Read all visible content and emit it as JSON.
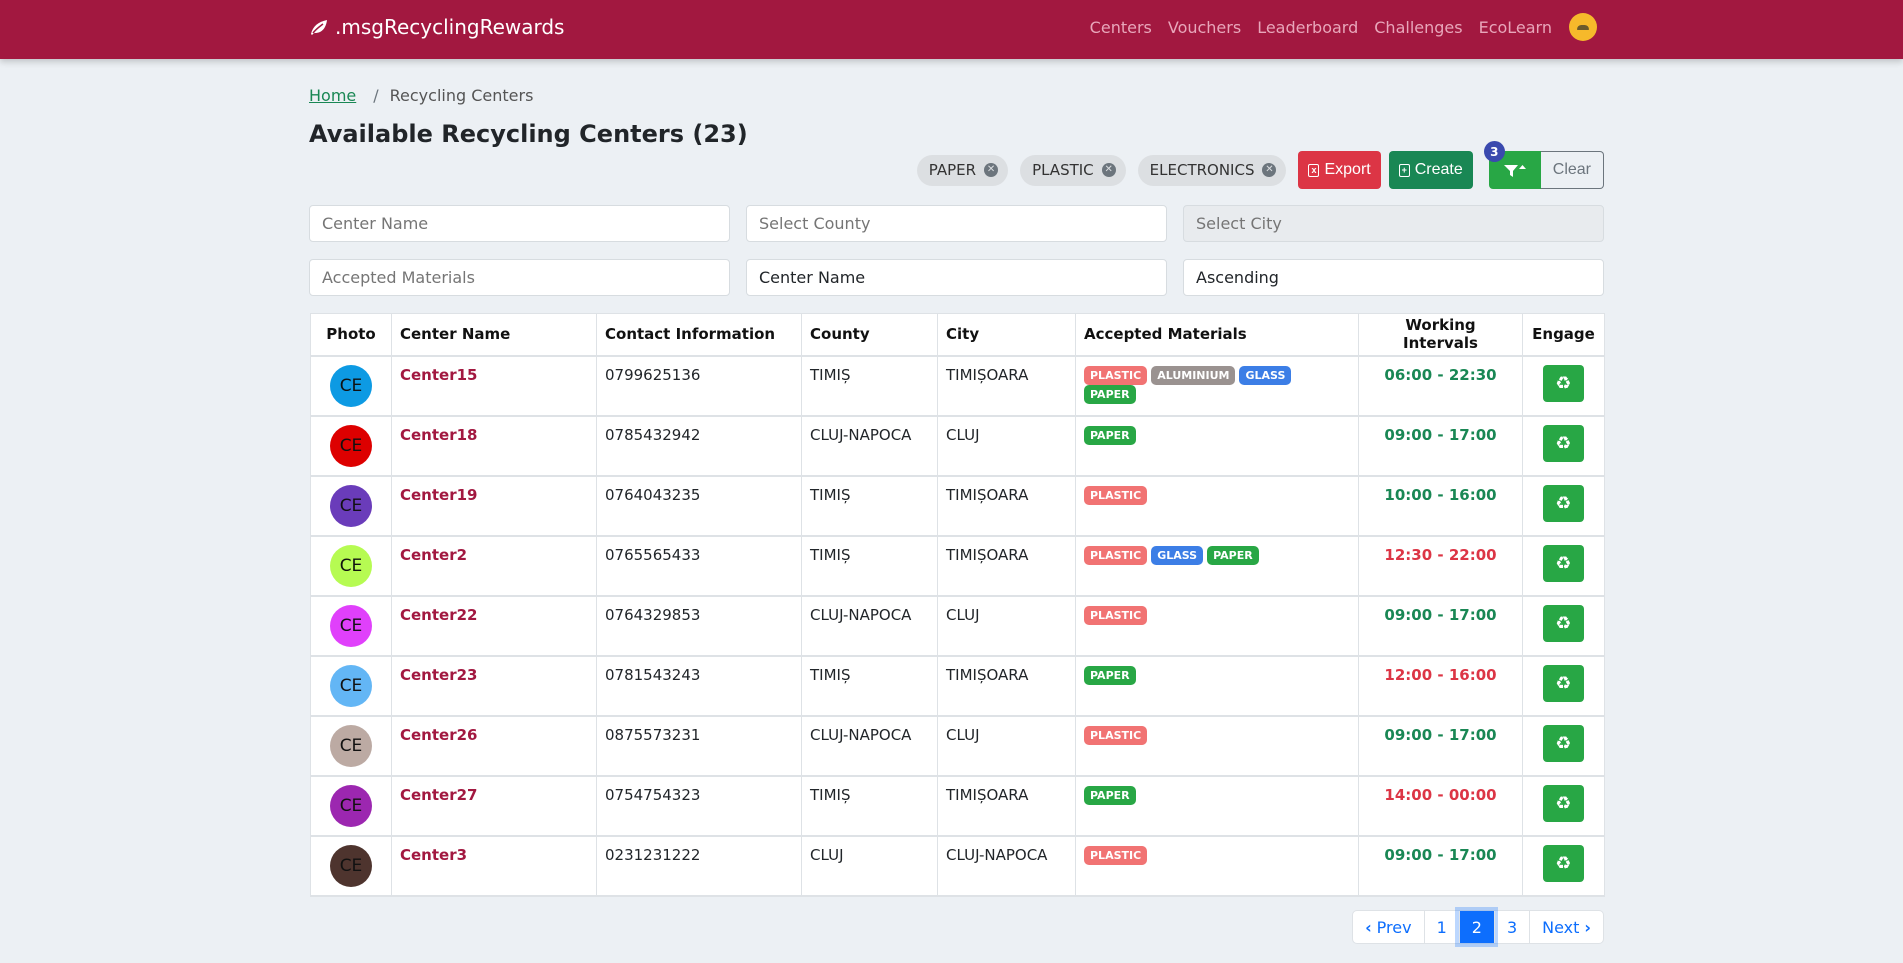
{
  "navbar": {
    "brand": ".msgRecyclingRewards",
    "links": [
      "Centers",
      "Vouchers",
      "Leaderboard",
      "Challenges",
      "EcoLearn"
    ]
  },
  "breadcrumb": {
    "home": "Home",
    "separator": "/",
    "current": "Recycling Centers"
  },
  "page_title": "Available Recycling Centers (23)",
  "toolbar": {
    "chips": [
      "PAPER",
      "PLASTIC",
      "ELECTRONICS"
    ],
    "export_label": "Export",
    "create_label": "Create",
    "filter_count": "3",
    "clear_label": "Clear"
  },
  "filters": {
    "center_name_placeholder": "Center Name",
    "county_placeholder": "Select County",
    "city_placeholder": "Select City",
    "materials_placeholder": "Accepted Materials",
    "sort_field": "Center Name",
    "sort_order": "Ascending"
  },
  "table": {
    "headers": [
      "Photo",
      "Center Name",
      "Contact Information",
      "County",
      "City",
      "Accepted Materials",
      "Working Intervals",
      "Engage"
    ],
    "rows": [
      {
        "initials": "CE",
        "avatar_color": "#0d9ae3",
        "name": "Center15",
        "contact": "0799625136",
        "county": "TIMIȘ",
        "city": "TIMIȘOARA",
        "materials": [
          "PLASTIC",
          "ALUMINIUM",
          "GLASS",
          "PAPER"
        ],
        "hours": "06:00 - 22:30",
        "open": true
      },
      {
        "initials": "CE",
        "avatar_color": "#dd0000",
        "name": "Center18",
        "contact": "0785432942",
        "county": "CLUJ-NAPOCA",
        "city": "CLUJ",
        "materials": [
          "PAPER"
        ],
        "hours": "09:00 - 17:00",
        "open": true
      },
      {
        "initials": "CE",
        "avatar_color": "#6a3cba",
        "name": "Center19",
        "contact": "0764043235",
        "county": "TIMIȘ",
        "city": "TIMIȘOARA",
        "materials": [
          "PLASTIC"
        ],
        "hours": "10:00 - 16:00",
        "open": true
      },
      {
        "initials": "CE",
        "avatar_color": "#b6fb52",
        "name": "Center2",
        "contact": "0765565433",
        "county": "TIMIȘ",
        "city": "TIMIȘOARA",
        "materials": [
          "PLASTIC",
          "GLASS",
          "PAPER"
        ],
        "hours": "12:30 - 22:00",
        "open": false
      },
      {
        "initials": "CE",
        "avatar_color": "#e040fb",
        "name": "Center22",
        "contact": "0764329853",
        "county": "CLUJ-NAPOCA",
        "city": "CLUJ",
        "materials": [
          "PLASTIC"
        ],
        "hours": "09:00 - 17:00",
        "open": true
      },
      {
        "initials": "CE",
        "avatar_color": "#63b6f5",
        "name": "Center23",
        "contact": "0781543243",
        "county": "TIMIȘ",
        "city": "TIMIȘOARA",
        "materials": [
          "PAPER"
        ],
        "hours": "12:00 - 16:00",
        "open": false
      },
      {
        "initials": "CE",
        "avatar_color": "#bcaaa3",
        "name": "Center26",
        "contact": "0875573231",
        "county": "CLUJ-NAPOCA",
        "city": "CLUJ",
        "materials": [
          "PLASTIC"
        ],
        "hours": "09:00 - 17:00",
        "open": true
      },
      {
        "initials": "CE",
        "avatar_color": "#9c27b0",
        "name": "Center27",
        "contact": "0754754323",
        "county": "TIMIȘ",
        "city": "TIMIȘOARA",
        "materials": [
          "PAPER"
        ],
        "hours": "14:00 - 00:00",
        "open": false
      },
      {
        "initials": "CE",
        "avatar_color": "#4e342e",
        "name": "Center3",
        "contact": "0231231222",
        "county": "CLUJ",
        "city": "CLUJ-NAPOCA",
        "materials": [
          "PLASTIC"
        ],
        "hours": "09:00 - 17:00",
        "open": true
      }
    ]
  },
  "material_colors": {
    "PLASTIC": "#f17373",
    "ALUMINIUM": "#9a9290",
    "GLASS": "#3c7ee6",
    "PAPER": "#28a745"
  },
  "status_colors": {
    "open": "#198754",
    "closed": "#dc3545"
  },
  "pagination": {
    "prev_label": "Prev",
    "pages": [
      "1",
      "2",
      "3"
    ],
    "current_page": "2",
    "next_label": "Next"
  }
}
